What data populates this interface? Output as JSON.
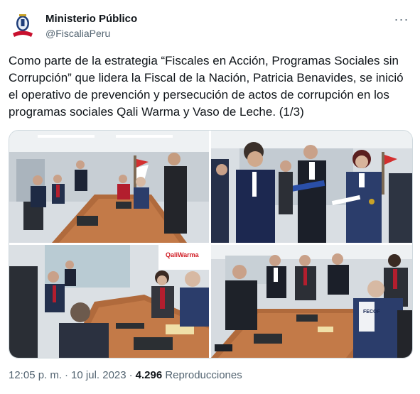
{
  "account": {
    "display_name": "Ministerio Público",
    "handle": "@FiscaliaPeru",
    "avatar_icon": "institutional-seal-icon"
  },
  "more_menu": {
    "icon": "more-options-icon",
    "label": "···"
  },
  "tweet": {
    "text": "Como parte de la estrategia “Fiscales en Acción, Programas Sociales sin Corrupción” que lidera la Fiscal de la Nación, Patricia Benavides, se inició el operativo de prevención y persecución de actos de corrupción en los programas sociales Qali Warma y Vaso de Leche. (1/3)"
  },
  "media": {
    "photos": [
      {
        "subject": "meeting-room-table-officials"
      },
      {
        "subject": "officials-reviewing-documents"
      },
      {
        "subject": "fiscal-meeting-qaliwarma-banner",
        "banner_text": "QaliWarma"
      },
      {
        "subject": "fiscal-team-meeting-table",
        "vest_text": "FECOF"
      }
    ]
  },
  "meta": {
    "time": "12:05 p. m.",
    "separator": "·",
    "date": "10 jul. 2023",
    "views_count": "4.296",
    "views_label": "Reproducciones"
  },
  "colors": {
    "text": "#0f1419",
    "secondary": "#536471",
    "border": "#cfd9de",
    "seal_red": "#c8102e"
  }
}
